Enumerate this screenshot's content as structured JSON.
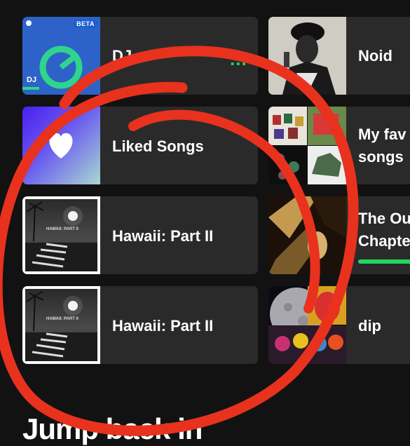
{
  "shortcuts_left": [
    {
      "label": "DJ",
      "badge": "BETA",
      "corner_text": "DJ",
      "more": "...",
      "kind": "dj"
    },
    {
      "label": "Liked Songs",
      "kind": "liked"
    },
    {
      "label": "Hawaii: Part II",
      "kind": "hawaii",
      "art_text": "HAWAII: PART II"
    },
    {
      "label": "Hawaii: Part II",
      "kind": "hawaii",
      "art_text": "HAWAII: PART II"
    }
  ],
  "shortcuts_right": [
    {
      "label": "Noid",
      "kind": "portrait"
    },
    {
      "label_line1": "My fav",
      "label_line2": "songs",
      "kind": "collage"
    },
    {
      "label_line1": "The Ou",
      "label_line2": "Chapte",
      "progress": 0.6,
      "kind": "dark"
    },
    {
      "label": "dip",
      "kind": "moon"
    }
  ],
  "section_heading": "Jump back in",
  "colors": {
    "accent": "#1ed760",
    "annotation": "#e8321e",
    "tile": "#2a2a2a",
    "background": "#121212"
  },
  "icons": [
    "heart-icon",
    "spotify-logo-icon",
    "more-options-icon"
  ]
}
